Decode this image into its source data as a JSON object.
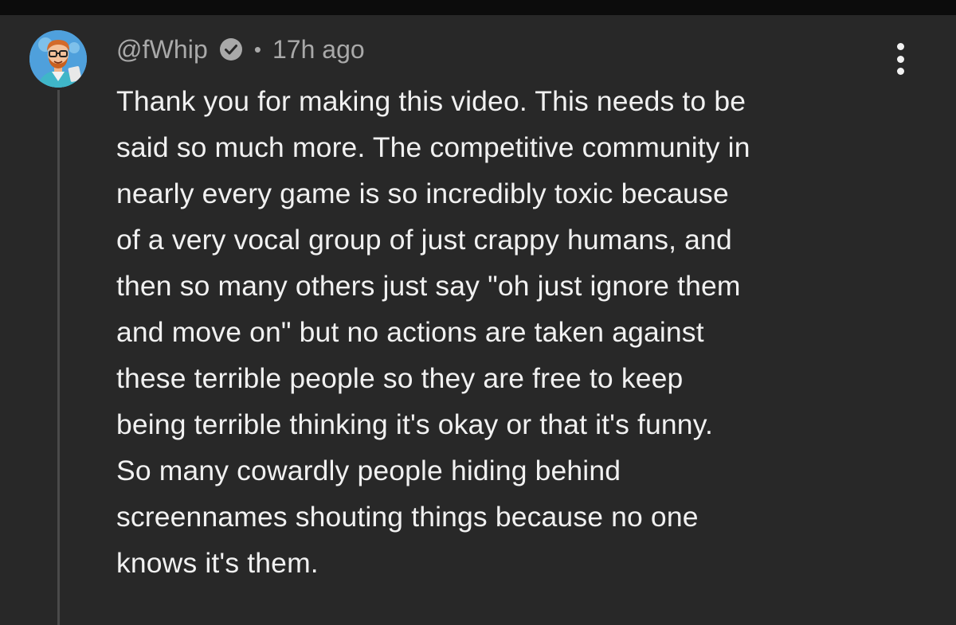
{
  "comment": {
    "author": "@fWhip",
    "separator": "•",
    "timestamp": "17h ago",
    "verified_icon": "verified-check-icon",
    "avatar_icon": "cartoon-avatar-icon",
    "menu_icon": "more-vertical-icon",
    "body_lines": [
      "Thank you for making this video. This needs to be",
      "said so much more. The competitive community in",
      "nearly every game is so incredibly toxic because",
      "of a very vocal group of just crappy humans, and",
      "then so many others just say \"oh just ignore them",
      "and move on\" but no actions are taken against",
      "these terrible people so they are free to keep",
      "being terrible thinking it's okay or that it's funny.",
      "So many cowardly people hiding behind",
      "screennames shouting things because no one",
      "knows it's them."
    ]
  },
  "colors": {
    "background": "#282828",
    "top_strip": "#0c0c0c",
    "meta_text": "#a9a9a9",
    "body_text": "#f1f1f1",
    "thread_line": "#4a4a4a",
    "avatar_bg": "#4fa0dc"
  }
}
